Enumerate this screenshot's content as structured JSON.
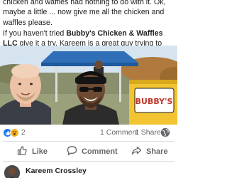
{
  "post": {
    "paragraph1": "chicken and waffles had nothing to do with it. Ok, maybe a little ... now give me all the chicken and waffles please.",
    "paragraph2_before": "If you haven't tried ",
    "paragraph2_bold": "Bubby's Chicken & Waffles LLC",
    "paragraph2_after": " give it a try. Kareem is a great guy trying to make his dream happen!"
  },
  "photo": {
    "sign_text": "BUBBY'S"
  },
  "reactions": {
    "count": "2",
    "comments": "1 Comment",
    "shares": "1 Share",
    "like_color": "#1877f2",
    "wow_color": "#f7b125"
  },
  "actions": {
    "like": "Like",
    "comment": "Comment",
    "share": "Share"
  },
  "comment": {
    "author": "Kareem Crossley"
  }
}
